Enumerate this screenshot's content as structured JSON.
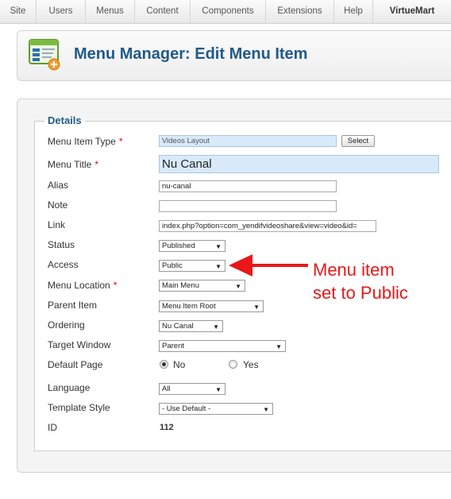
{
  "menubar": {
    "items": [
      "Site",
      "Users",
      "Menus",
      "Content",
      "Components",
      "Extensions",
      "Help",
      "VirtueMart"
    ]
  },
  "header": {
    "title": "Menu Manager: Edit Menu Item",
    "icon": "menu-manager-icon"
  },
  "details": {
    "legend": "Details",
    "fields": {
      "menu_item_type": {
        "label": "Menu Item Type",
        "required": "*",
        "value": "Videos Layout",
        "button": "Select"
      },
      "menu_title": {
        "label": "Menu Title",
        "required": "*",
        "value": "Nu Canal"
      },
      "alias": {
        "label": "Alias",
        "value": "nu-canal"
      },
      "note": {
        "label": "Note",
        "value": ""
      },
      "link": {
        "label": "Link",
        "value": "index.php?option=com_yendifvideoshare&view=video&id="
      },
      "status": {
        "label": "Status",
        "value": "Published"
      },
      "access": {
        "label": "Access",
        "value": "Public"
      },
      "menu_location": {
        "label": "Menu Location",
        "required": "*",
        "value": "Main Menu"
      },
      "parent_item": {
        "label": "Parent Item",
        "value": "Menu Item Root"
      },
      "ordering": {
        "label": "Ordering",
        "value": "Nu Canal"
      },
      "target_window": {
        "label": "Target Window",
        "value": "Parent"
      },
      "default_page": {
        "label": "Default Page",
        "no": "No",
        "yes": "Yes",
        "selected": "No"
      },
      "language": {
        "label": "Language",
        "value": "All"
      },
      "template_style": {
        "label": "Template Style",
        "value": "- Use Default -"
      },
      "id": {
        "label": "ID",
        "value": "112"
      }
    }
  },
  "annotation": {
    "line1": "Menu item",
    "line2": "set to Public",
    "color": "#e81818"
  },
  "colors": {
    "title_blue": "#215a89",
    "required_red": "#dd0000",
    "input_highlight": "#d8eafa"
  }
}
